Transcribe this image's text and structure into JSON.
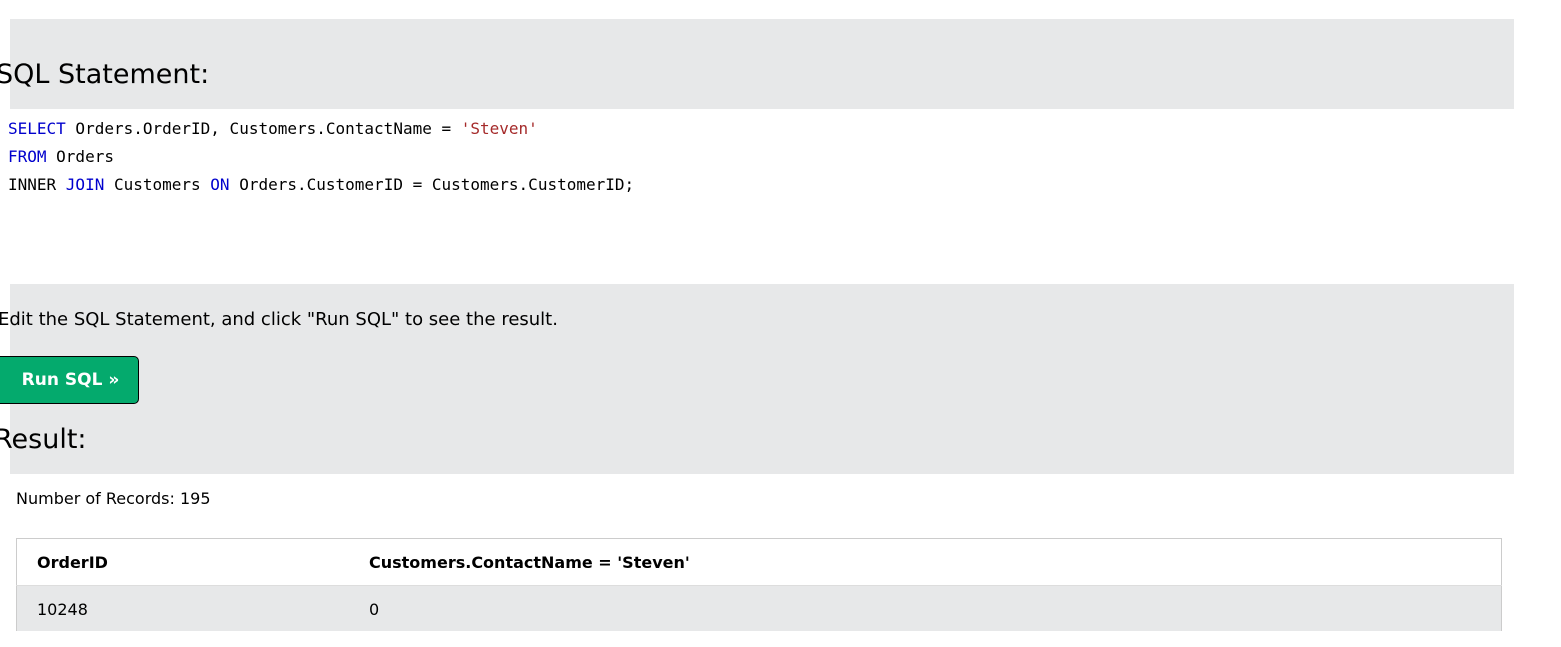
{
  "sql_section": {
    "heading": "SQL Statement:",
    "code_lines": [
      [
        {
          "text": "SELECT",
          "kind": "kw"
        },
        {
          "text": " Orders.OrderID, Customers.ContactName = ",
          "kind": "id"
        },
        {
          "text": "'Steven'",
          "kind": "str"
        }
      ],
      [
        {
          "text": "FROM",
          "kind": "kw"
        },
        {
          "text": " Orders",
          "kind": "id"
        }
      ],
      [
        {
          "text": "INNER ",
          "kind": "id"
        },
        {
          "text": "JOIN",
          "kind": "kw"
        },
        {
          "text": " Customers ",
          "kind": "id"
        },
        {
          "text": "ON",
          "kind": "kw"
        },
        {
          "text": " Orders.CustomerID = Customers.CustomerID;",
          "kind": "id"
        }
      ]
    ]
  },
  "instruction_text": "Edit the SQL Statement, and click \"Run SQL\" to see the result.",
  "run_button_label": "Run SQL »",
  "result_section": {
    "heading": "Result:",
    "record_count_text": "Number of Records: 195",
    "table": {
      "headers": [
        "OrderID",
        "Customers.ContactName = 'Steven'"
      ],
      "rows": [
        [
          "10248",
          "0"
        ]
      ]
    }
  },
  "colors": {
    "band_background": "#e7e8e9",
    "button_green": "#04aa6d",
    "sql_keyword": "#0000cd",
    "sql_string": "#a52a2a"
  }
}
